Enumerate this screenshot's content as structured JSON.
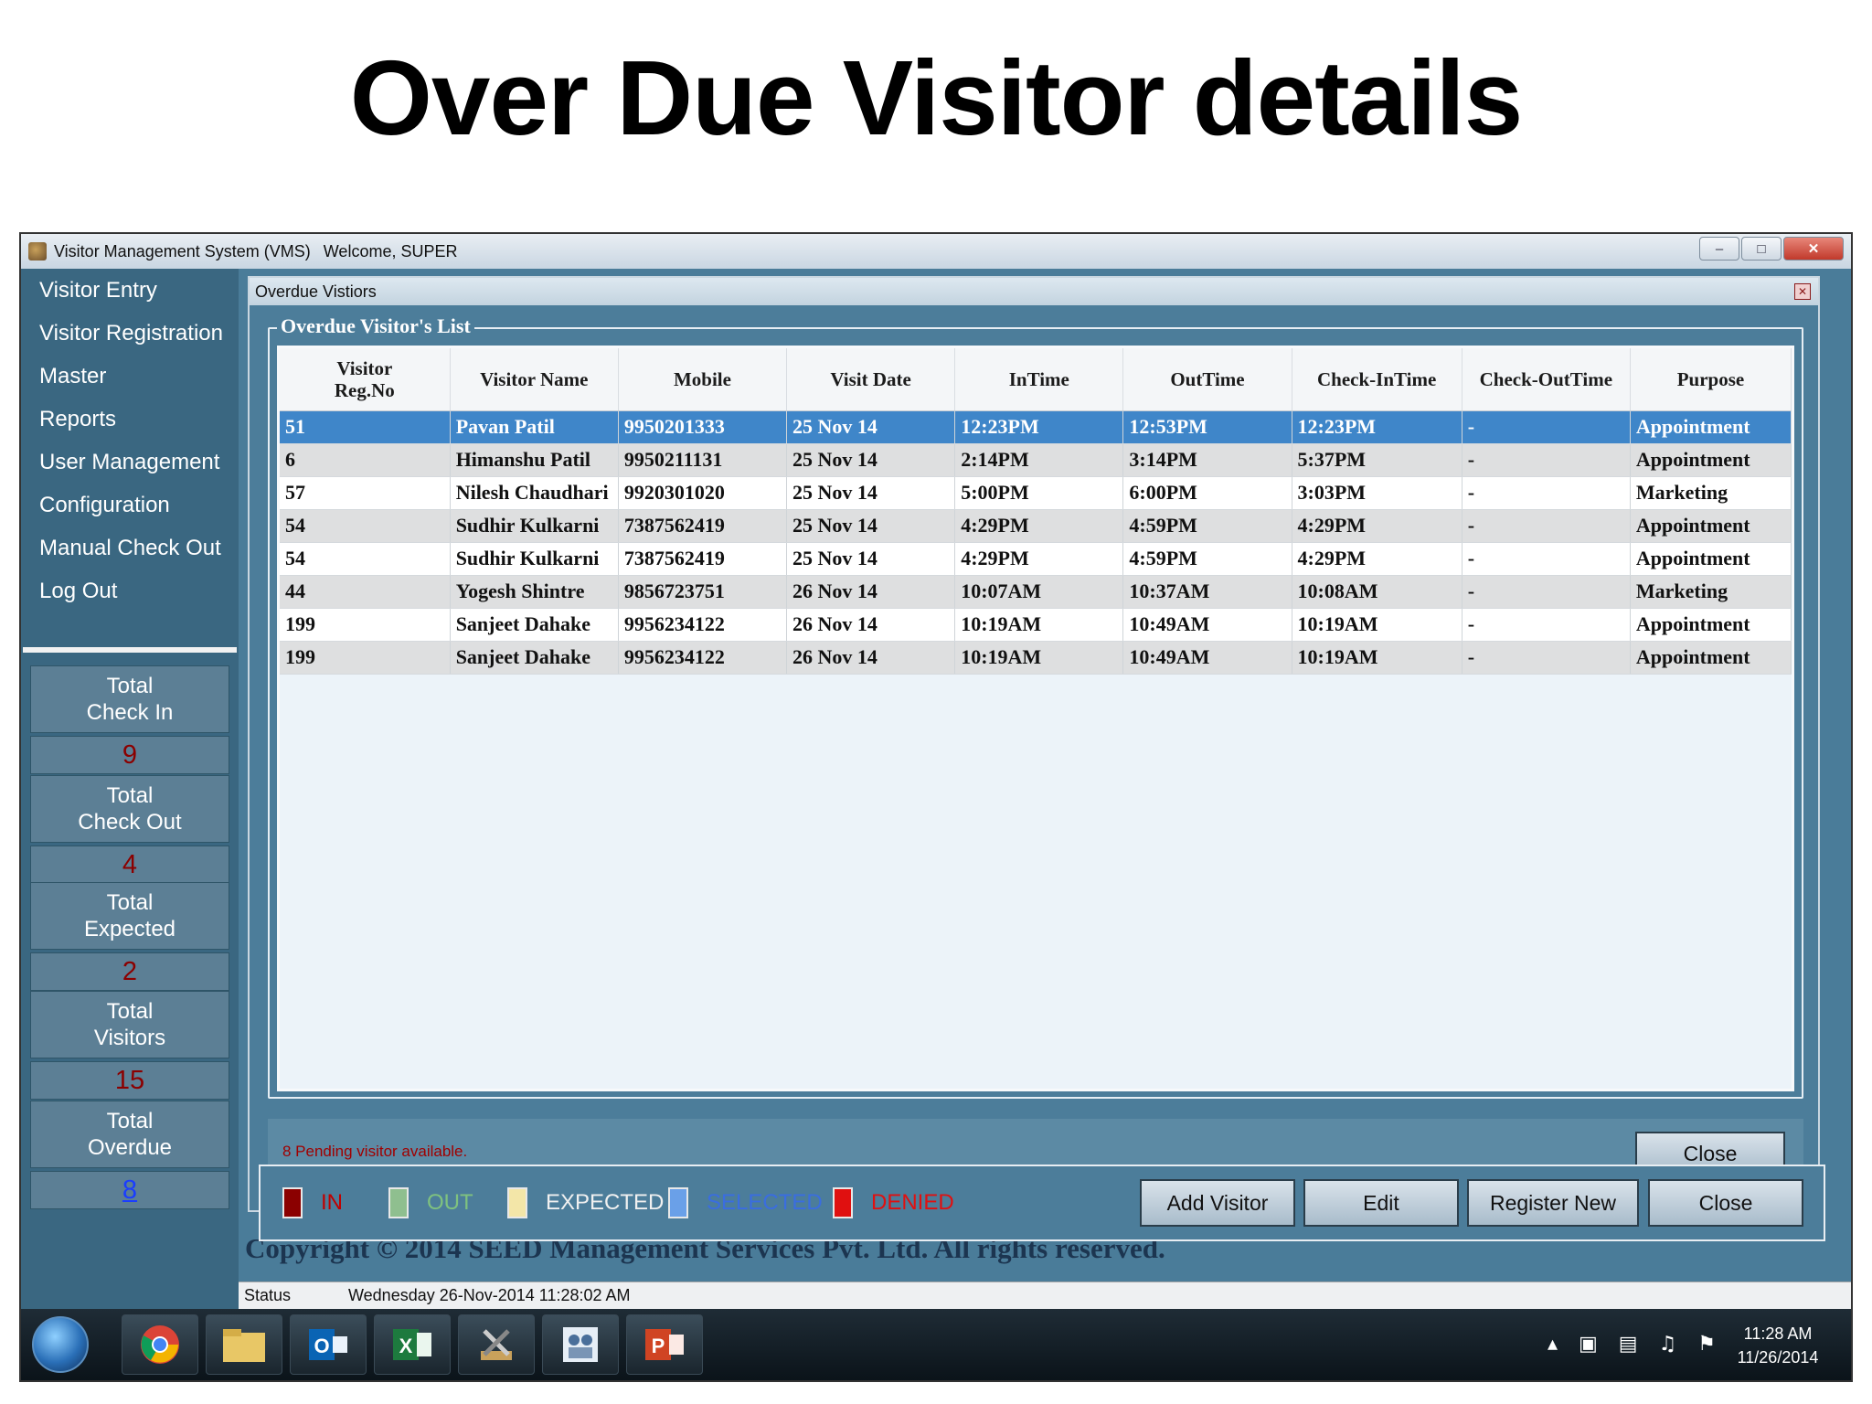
{
  "slide": {
    "title": "Over Due Visitor details"
  },
  "window": {
    "title": "Visitor Management System (VMS)",
    "welcome": "Welcome, SUPER",
    "controls": [
      "minimize-icon",
      "maximize-icon",
      "close-icon"
    ]
  },
  "sidebar": {
    "items": [
      {
        "label": "Visitor Entry"
      },
      {
        "label": "Visitor Registration"
      },
      {
        "label": "Master"
      },
      {
        "label": "Reports"
      },
      {
        "label": "User Management"
      },
      {
        "label": "Configuration"
      },
      {
        "label": "Manual Check Out"
      },
      {
        "label": "Log Out"
      }
    ],
    "stats": [
      {
        "label": "Total\nCheck In",
        "value": "9"
      },
      {
        "label": "Total\nCheck Out",
        "value": "4"
      },
      {
        "label": "Total\nExpected",
        "value": "2"
      },
      {
        "label": "Total\nVisitors",
        "value": "15"
      },
      {
        "label": "Total\nOverdue",
        "value": "8"
      }
    ]
  },
  "dialog": {
    "title": "Overdue Vistiors",
    "group_title": "Overdue Visitor's List",
    "columns": [
      "Visitor\nReg.No",
      "Visitor Name",
      "Mobile",
      "Visit Date",
      "InTime",
      "OutTime",
      "Check-InTime",
      "Check-OutTime",
      "Purpose"
    ],
    "rows": [
      [
        "51",
        "Pavan Patil",
        "9950201333",
        "25 Nov 14",
        "12:23PM",
        "12:53PM",
        "12:23PM",
        "-",
        "Appointment"
      ],
      [
        "6",
        "Himanshu Patil",
        "9950211131",
        "25 Nov 14",
        " 2:14PM",
        " 3:14PM",
        " 5:37PM",
        "-",
        "Appointment"
      ],
      [
        "57",
        "Nilesh Chaudhari",
        "9920301020",
        "25 Nov 14",
        " 5:00PM",
        " 6:00PM",
        " 3:03PM",
        "-",
        "Marketing"
      ],
      [
        "54",
        "Sudhir Kulkarni",
        "7387562419",
        "25 Nov 14",
        " 4:29PM",
        " 4:59PM",
        " 4:29PM",
        "-",
        "Appointment"
      ],
      [
        "54",
        "Sudhir Kulkarni",
        "7387562419",
        "25 Nov 14",
        " 4:29PM",
        " 4:59PM",
        " 4:29PM",
        "-",
        "Appointment"
      ],
      [
        "44",
        "Yogesh Shintre",
        "9856723751",
        "26 Nov 14",
        "10:07AM",
        "10:37AM",
        "10:08AM",
        "-",
        "Marketing"
      ],
      [
        "199",
        "Sanjeet Dahake",
        "9956234122",
        "26 Nov 14",
        "10:19AM",
        "10:49AM",
        "10:19AM",
        "-",
        "Appointment"
      ],
      [
        "199",
        "Sanjeet Dahake",
        "9956234122",
        "26 Nov 14",
        "10:19AM",
        "10:49AM",
        "10:19AM",
        "-",
        "Appointment"
      ]
    ],
    "selected_row": 0,
    "pending_text": "8 Pending visitor available.",
    "close_label": "Close"
  },
  "legend": {
    "items": [
      {
        "label": "IN",
        "color": "#8b0000",
        "text_color": "#c00000"
      },
      {
        "label": "OUT",
        "color": "#8fbf8f",
        "text_color": "#7fc27f"
      },
      {
        "label": "EXPECTED",
        "color": "#f3e6a8",
        "text_color": "#f0f0f0"
      },
      {
        "label": "SELECTED",
        "color": "#6aa0e8",
        "text_color": "#3a6de0"
      },
      {
        "label": "DENIED",
        "color": "#e01010",
        "text_color": "#e01010"
      }
    ]
  },
  "actions": {
    "add_visitor": "Add Visitor",
    "edit": "Edit",
    "register_new": "Register New",
    "close": "Close"
  },
  "copyright": "Copyright © 2014 SEED Management Services Pvt. Ltd. All rights reserved.",
  "status": {
    "label": "Status",
    "datetime": "Wednesday 26-Nov-2014 11:28:02 AM"
  },
  "taskbar": {
    "apps": [
      "start-orb-icon",
      "chrome-icon",
      "file-explorer-icon",
      "outlook-icon",
      "excel-icon",
      "tools-icon",
      "vms-icon",
      "powerpoint-icon"
    ],
    "time": "11:28 AM",
    "date": "11/26/2014"
  }
}
